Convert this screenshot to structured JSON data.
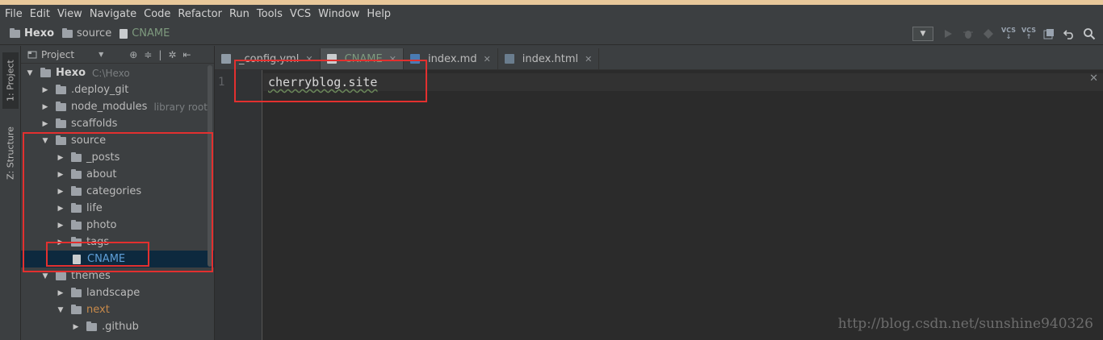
{
  "menu": [
    "File",
    "Edit",
    "View",
    "Navigate",
    "Code",
    "Refactor",
    "Run",
    "Tools",
    "VCS",
    "Window",
    "Help"
  ],
  "breadcrumbs": [
    {
      "label": "Hexo",
      "type": "folder",
      "bold": true
    },
    {
      "label": "source",
      "type": "folder",
      "bold": false
    },
    {
      "label": "CNAME",
      "type": "file",
      "bold": false
    }
  ],
  "toolbar": {
    "run_config_caret": "▼",
    "vcs_update": "VCS",
    "vcs_commit": "VCS"
  },
  "side_tabs": {
    "project": "1: Project",
    "structure": "Z: Structure"
  },
  "project_panel": {
    "title": "Project",
    "caret": "▼",
    "tree": [
      {
        "label": "Hexo",
        "hint": "C:\\Hexo",
        "depth": 0,
        "expanded": true,
        "kind": "folder",
        "style": "bold"
      },
      {
        "label": ".deploy_git",
        "hint": "",
        "depth": 1,
        "expanded": false,
        "kind": "folder",
        "style": ""
      },
      {
        "label": "node_modules",
        "hint": "library root",
        "depth": 1,
        "expanded": false,
        "kind": "folder",
        "style": ""
      },
      {
        "label": "scaffolds",
        "hint": "",
        "depth": 1,
        "expanded": false,
        "kind": "folder",
        "style": ""
      },
      {
        "label": "source",
        "hint": "",
        "depth": 1,
        "expanded": true,
        "kind": "folder",
        "style": ""
      },
      {
        "label": "_posts",
        "hint": "",
        "depth": 2,
        "expanded": false,
        "kind": "folder",
        "style": ""
      },
      {
        "label": "about",
        "hint": "",
        "depth": 2,
        "expanded": false,
        "kind": "folder",
        "style": ""
      },
      {
        "label": "categories",
        "hint": "",
        "depth": 2,
        "expanded": false,
        "kind": "folder",
        "style": ""
      },
      {
        "label": "life",
        "hint": "",
        "depth": 2,
        "expanded": false,
        "kind": "folder",
        "style": ""
      },
      {
        "label": "photo",
        "hint": "",
        "depth": 2,
        "expanded": false,
        "kind": "folder",
        "style": ""
      },
      {
        "label": "tags",
        "hint": "",
        "depth": 2,
        "expanded": false,
        "kind": "folder",
        "style": ""
      },
      {
        "label": "CNAME",
        "hint": "",
        "depth": 2,
        "expanded": null,
        "kind": "file",
        "style": "selected"
      },
      {
        "label": "themes",
        "hint": "",
        "depth": 1,
        "expanded": true,
        "kind": "folder",
        "style": ""
      },
      {
        "label": "landscape",
        "hint": "",
        "depth": 2,
        "expanded": false,
        "kind": "folder",
        "style": ""
      },
      {
        "label": "next",
        "hint": "",
        "depth": 2,
        "expanded": true,
        "kind": "folder",
        "style": "orange"
      },
      {
        "label": ".github",
        "hint": "",
        "depth": 3,
        "expanded": false,
        "kind": "folder",
        "style": ""
      }
    ]
  },
  "editor_tabs": [
    {
      "label": "_config.yml",
      "active": false,
      "icon_color": "#8f9ba6"
    },
    {
      "label": "CNAME",
      "active": true,
      "icon_color": "#c9ccce"
    },
    {
      "label": "index.md",
      "active": false,
      "icon_color": "#4a7bb3"
    },
    {
      "label": "index.html",
      "active": false,
      "icon_color": "#6a7d8e"
    }
  ],
  "editor": {
    "line_number": "1",
    "line_text": "cherryblog.site"
  },
  "watermark": "http://blog.csdn.net/sunshine940326",
  "colors": {
    "annotation_red": "#e3302f",
    "selection": "#0d293e",
    "editor_bg": "#2b2b2b"
  }
}
